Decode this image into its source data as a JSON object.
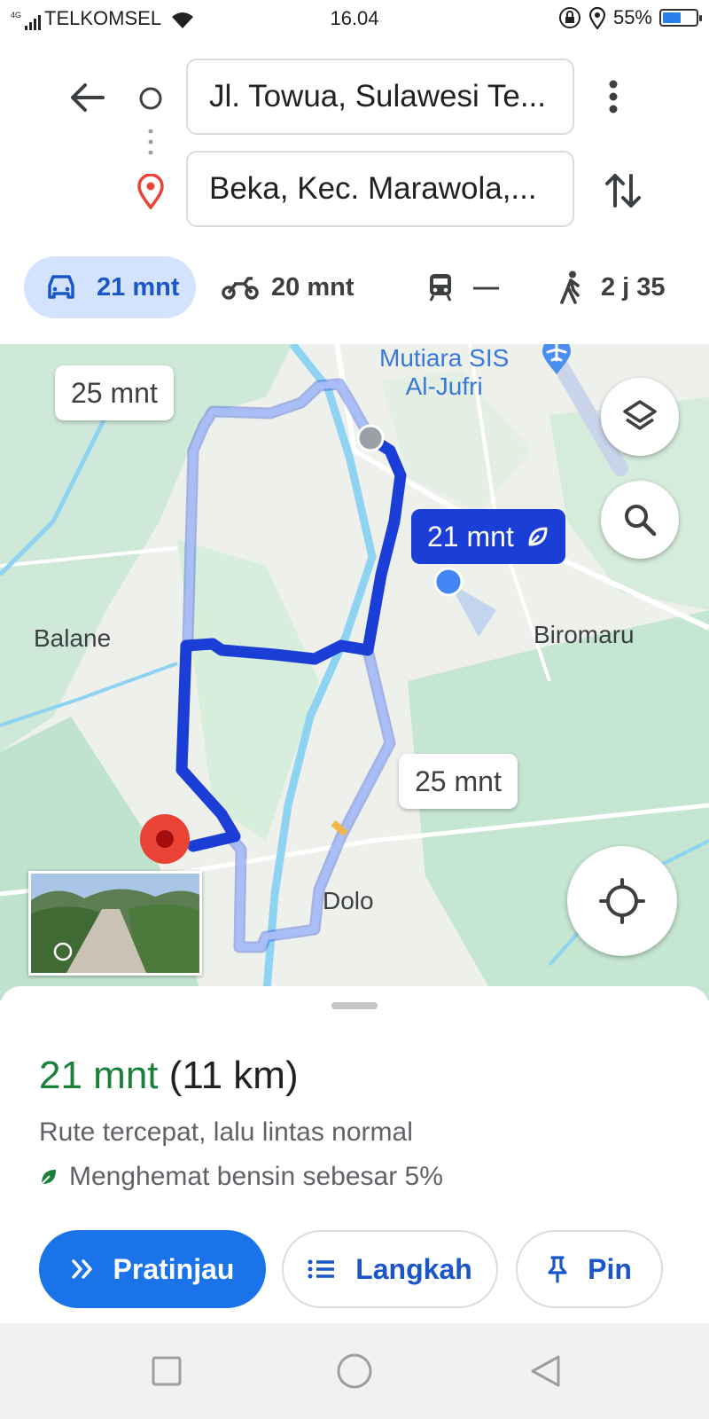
{
  "status_bar": {
    "network": "4G",
    "carrier": "TELKOMSEL",
    "time": "16.04",
    "battery": "55%",
    "battery_level": 0.55
  },
  "search": {
    "origin": "Jl. Towua, Sulawesi Te...",
    "destination": "Beka, Kec. Marawola,..."
  },
  "travel_modes": [
    {
      "name": "car",
      "label": "21 mnt",
      "selected": true
    },
    {
      "name": "motorcycle",
      "label": "20 mnt",
      "selected": false
    },
    {
      "name": "transit",
      "label": "—",
      "selected": false
    },
    {
      "name": "walk",
      "label": "2 j 35",
      "selected": false
    }
  ],
  "map": {
    "places": {
      "mutiara_line1": "Mutiara SIS",
      "mutiara_line2": "Al-Jufri",
      "balane": "Balane",
      "biromaru": "Biromaru",
      "dolo": "Dolo"
    },
    "alt_route_top": "25 mnt",
    "alt_route_right": "25 mnt",
    "selected_route": "21 mnt",
    "colors": {
      "selected_route": "#1a3ed6",
      "alt_route": "#9fb4f5",
      "destination_pin": "#ea4335",
      "my_location": "#4285f4"
    }
  },
  "sheet": {
    "duration": "21 mnt",
    "distance": "(11 km)",
    "description": "Rute tercepat, lalu lintas normal",
    "eco": "Menghemat bensin sebesar 5%",
    "buttons": {
      "preview": "Pratinjau",
      "steps": "Langkah",
      "pin": "Pin"
    }
  },
  "icons": [
    "back-arrow-icon",
    "more-vert-icon",
    "swap-icon",
    "car-icon",
    "motorcycle-icon",
    "train-icon",
    "walk-icon",
    "layers-icon",
    "search-icon",
    "my-location-icon",
    "leaf-icon",
    "double-chevron-icon",
    "list-icon",
    "pin-icon"
  ]
}
